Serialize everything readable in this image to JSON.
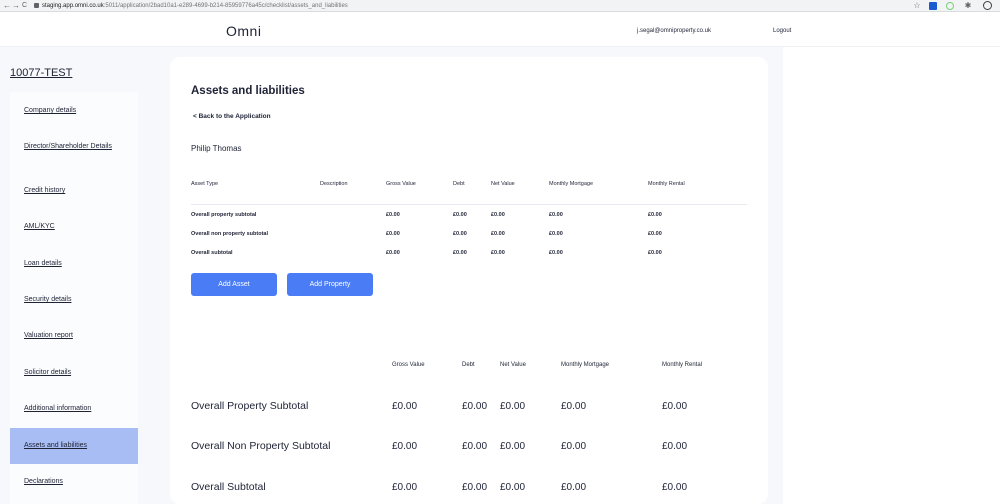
{
  "browser": {
    "back": "←",
    "forward": "→",
    "reload": "C",
    "url_host": "staging.app.omni.co.uk",
    "url_path": ":5011/application/2bad10a1-e289-4699-b214-85959776a45c/checklist/assets_and_liabilities",
    "star": "☆",
    "puzzle": "✱"
  },
  "header": {
    "logo": "Omni",
    "email": "j.segal@omniproperty.co.uk",
    "logout": "Logout"
  },
  "sidebar": {
    "application_id": "10077-TEST",
    "items": [
      {
        "label": "Company details"
      },
      {
        "label": "Director/Shareholder Details"
      },
      {
        "label": "Credit history"
      },
      {
        "label": "AML/KYC"
      },
      {
        "label": "Loan details"
      },
      {
        "label": "Security details"
      },
      {
        "label": "Valuation report"
      },
      {
        "label": "Solicitor details"
      },
      {
        "label": "Additional information"
      },
      {
        "label": "Assets and liabilities",
        "active": true
      },
      {
        "label": "Declarations"
      }
    ]
  },
  "main": {
    "title": "Assets and liabilities",
    "back_link": "< Back to the Application",
    "person_name": "Philip Thomas",
    "table": {
      "columns": [
        "Asset Type",
        "Description",
        "Gross Value",
        "Debt",
        "Net Value",
        "Monthly Mortgage",
        "Monthly Rental"
      ],
      "rows": [
        {
          "label": "Overall property subtotal",
          "values": [
            "£0.00",
            "£0.00",
            "£0.00",
            "£0.00",
            "£0.00"
          ]
        },
        {
          "label": "Overall non property subtotal",
          "values": [
            "£0.00",
            "£0.00",
            "£0.00",
            "£0.00",
            "£0.00"
          ]
        },
        {
          "label": "Overall subtotal",
          "values": [
            "£0.00",
            "£0.00",
            "£0.00",
            "£0.00",
            "£0.00"
          ]
        }
      ]
    },
    "add_asset_label": "Add Asset",
    "add_property_label": "Add Property",
    "summary": {
      "columns": [
        "Gross Value",
        "Debt",
        "Net Value",
        "Monthly Mortgage",
        "Monthly Rental"
      ],
      "rows": [
        {
          "label": "Overall Property Subtotal",
          "values": [
            "£0.00",
            "£0.00",
            "£0.00",
            "£0.00",
            "£0.00"
          ]
        },
        {
          "label": "Overall Non Property Subtotal",
          "values": [
            "£0.00",
            "£0.00",
            "£0.00",
            "£0.00",
            "£0.00"
          ]
        },
        {
          "label": "Overall Subtotal",
          "values": [
            "£0.00",
            "£0.00",
            "£0.00",
            "£0.00",
            "£0.00"
          ]
        }
      ]
    }
  },
  "colors": {
    "accent": "#4a7cf6",
    "active_nav": "#a8bdf3",
    "text": "#1e2235"
  }
}
